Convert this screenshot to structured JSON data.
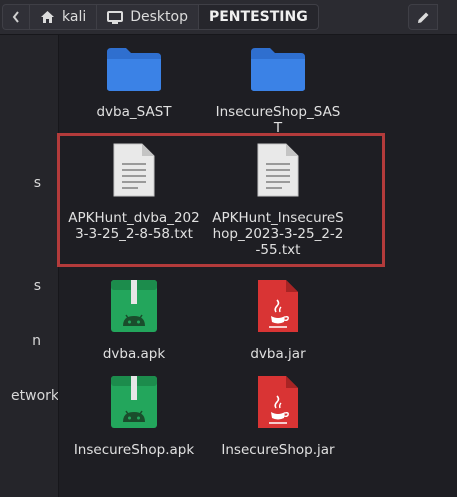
{
  "pathbar": {
    "segments": [
      "kali",
      "Desktop",
      "PENTESTING"
    ]
  },
  "sidebar": {
    "items": [
      "s",
      "s",
      "n",
      "etwork"
    ]
  },
  "files": [
    {
      "name": "dvba_SAST",
      "type": "folder-icon"
    },
    {
      "name": "InsecureShop_SAST",
      "type": "folder-icon"
    },
    {
      "name": "APKHunt_dvba_2023-3-25_2-8-58.txt",
      "type": "text-file-icon"
    },
    {
      "name": "APKHunt_InsecureShop_2023-3-25_2-2-55.txt",
      "type": "text-file-icon"
    },
    {
      "name": "dvba.apk",
      "type": "apk-file-icon"
    },
    {
      "name": "dvba.jar",
      "type": "jar-file-icon"
    },
    {
      "name": "InsecureShop.apk",
      "type": "apk-file-icon"
    },
    {
      "name": "InsecureShop.jar",
      "type": "jar-file-icon"
    }
  ],
  "colors": {
    "folder": "#3b7ddd",
    "apk": "#22a35a",
    "jar": "#d73232",
    "highlight": "#b33b3b"
  }
}
